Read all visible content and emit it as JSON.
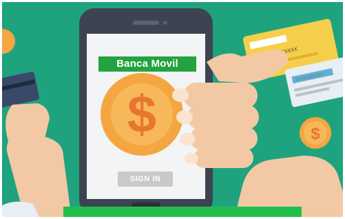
{
  "app_label": "Banca Movil",
  "sign_in_label": "SIGN IN",
  "card_front_text": "XXXXXXX XXXXX",
  "card_back_text": "XXXXXXXXXX",
  "currency_symbol": "$",
  "colors": {
    "background": "#1fa37f",
    "banner": "#22a33f",
    "coin": "#f4a640",
    "phone": "#3d4451"
  }
}
